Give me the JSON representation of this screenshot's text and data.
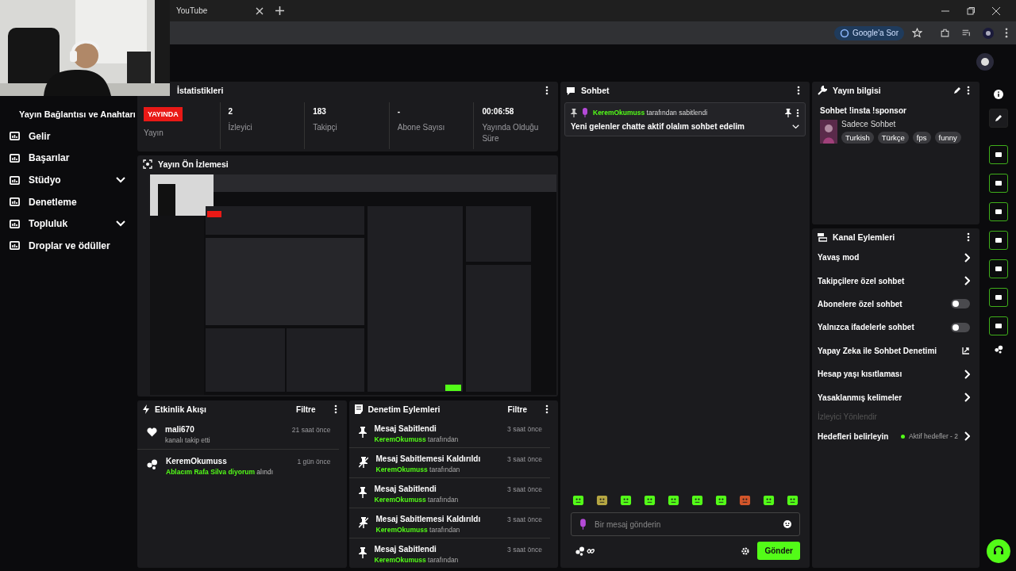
{
  "browser": {
    "tab_title": "YouTube",
    "ask_button": "Google'a Sor"
  },
  "sidebar": {
    "items": [
      {
        "label": "Yayın Bağlantısı ve Anahtarı",
        "kind": "sub",
        "selected": false,
        "expandable": false
      },
      {
        "label": "Gelir",
        "kind": "main",
        "selected": false,
        "expandable": false
      },
      {
        "label": "Başarılar",
        "kind": "main",
        "selected": false,
        "expandable": false
      },
      {
        "label": "Stüdyo",
        "kind": "main",
        "selected": false,
        "expandable": true
      },
      {
        "label": "Denetleme",
        "kind": "main",
        "selected": false,
        "expandable": false
      },
      {
        "label": "Topluluk",
        "kind": "main",
        "selected": false,
        "expandable": true
      },
      {
        "label": "Droplar ve ödüller",
        "kind": "main",
        "selected": false,
        "expandable": false
      }
    ]
  },
  "stats": {
    "title": "İstatistikleri",
    "live_badge": "YAYINDA",
    "live_label": "Yayın",
    "cells": [
      {
        "value": "2",
        "label": "İzleyici"
      },
      {
        "value": "183",
        "label": "Takipçi"
      },
      {
        "value": "-",
        "label": "Abone Sayısı"
      },
      {
        "value": "00:06:58",
        "label": "Yayında Olduğu Süre"
      }
    ]
  },
  "preview": {
    "title": "Yayın Ön İzlemesi",
    "kind": "picture"
  },
  "activity": {
    "title": "Etkinlik Akışı",
    "filter": "Filtre",
    "items": [
      {
        "kind": "follow",
        "user": "mali670",
        "time": "21 saat önce",
        "text": "kanalı takip etti"
      },
      {
        "kind": "reward",
        "user": "KeremOkumuss",
        "time": "1 gün önce",
        "highlight": "Ablacım Rafa Silva diyorum",
        "text": "alındı"
      }
    ]
  },
  "moderation": {
    "title": "Denetim Eylemleri",
    "filter": "Filtre",
    "items": [
      {
        "kind": "pin",
        "title": "Mesaj Sabitlendi",
        "user": "KeremOkumuss",
        "suffix": "tarafından",
        "time": "3 saat önce"
      },
      {
        "kind": "unpin",
        "title": "Mesaj Sabitlemesi Kaldırıldı",
        "user": "KeremOkumuss",
        "suffix": "tarafından",
        "time": "3 saat önce"
      },
      {
        "kind": "pin",
        "title": "Mesaj Sabitlendi",
        "user": "KeremOkumuss",
        "suffix": "tarafından",
        "time": "3 saat önce"
      },
      {
        "kind": "unpin",
        "title": "Mesaj Sabitlemesi Kaldırıldı",
        "user": "KeremOkumuss",
        "suffix": "tarafından",
        "time": "3 saat önce"
      },
      {
        "kind": "pin",
        "title": "Mesaj Sabitlendi",
        "user": "KeremOkumuss",
        "suffix": "tarafından",
        "time": "3 saat önce"
      }
    ]
  },
  "chat": {
    "title": "Sohbet",
    "pinned": {
      "user": "KeremOkumuss",
      "suffix": "tarafından sabitlendi",
      "message": "Yeni gelenler chatte aktif olalım sohbet edelim"
    },
    "placeholder": "Bir mesaj gönderin",
    "send": "Gönder"
  },
  "stream_info": {
    "title": "Yayın bilgisi",
    "heading": "Sohbet !insta !sponsor",
    "category": "Sadece Sohbet",
    "tags": [
      "Turkish",
      "Türkçe",
      "fps",
      "funny"
    ]
  },
  "channel_actions": {
    "title": "Kanal Eylemleri",
    "items": [
      {
        "kind": "arrow",
        "label": "Yavaş mod"
      },
      {
        "kind": "arrow",
        "label": "Takipçilere özel sohbet"
      },
      {
        "kind": "toggle",
        "label": "Abonelere özel sohbet",
        "on": false
      },
      {
        "kind": "toggle",
        "label": "Yalnızca ifadelerle sohbet",
        "on": false
      },
      {
        "kind": "external",
        "label": "Yapay Zeka ile Sohbet Denetimi"
      },
      {
        "kind": "arrow",
        "label": "Hesap yaşı kısıtlaması"
      },
      {
        "kind": "arrow",
        "label": "Yasaklanmış kelimeler"
      },
      {
        "kind": "section",
        "label": "İzleyici Yönlendir"
      },
      {
        "kind": "goal",
        "label": "Hedefleri belirleyin",
        "status": "Aktif hedefler - 2",
        "color": "#53fc18"
      }
    ]
  }
}
